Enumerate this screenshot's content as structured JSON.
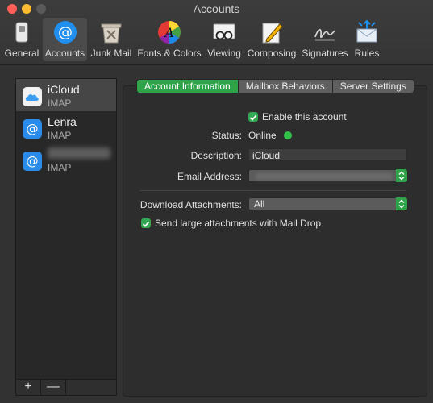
{
  "window": {
    "title": "Accounts"
  },
  "toolbar": {
    "items": [
      {
        "label": "General",
        "icon": "switch-icon"
      },
      {
        "label": "Accounts",
        "icon": "at-sign-icon"
      },
      {
        "label": "Junk Mail",
        "icon": "trash-icon"
      },
      {
        "label": "Fonts & Colors",
        "icon": "color-wheel-icon"
      },
      {
        "label": "Viewing",
        "icon": "glasses-icon"
      },
      {
        "label": "Composing",
        "icon": "pencil-icon"
      },
      {
        "label": "Signatures",
        "icon": "signature-icon"
      },
      {
        "label": "Rules",
        "icon": "envelope-arrows-icon"
      }
    ],
    "active": "Accounts"
  },
  "accounts": [
    {
      "name": "iCloud",
      "type": "IMAP",
      "icon": "cloud-icon",
      "selected": true
    },
    {
      "name": "Lenra",
      "type": "IMAP",
      "icon": "at-sign-icon",
      "selected": false
    },
    {
      "name": "",
      "type": "IMAP",
      "icon": "at-sign-icon",
      "selected": false
    }
  ],
  "list_footer": {
    "add": "+",
    "remove": "—"
  },
  "tabs": [
    "Account Information",
    "Mailbox Behaviors",
    "Server Settings"
  ],
  "active_tab": "Account Information",
  "form": {
    "enable_label": "Enable this account",
    "enable_checked": true,
    "status_label": "Status:",
    "status_value": "Online",
    "description_label": "Description:",
    "description_value": "iCloud",
    "email_label": "Email Address:",
    "download_label": "Download Attachments:",
    "download_value": "All",
    "maildrop_label": "Send large attachments with Mail Drop",
    "maildrop_checked": true
  },
  "colors": {
    "accent_green": "#2fa347",
    "status_online": "#33c04a",
    "window_bg": "#323232"
  }
}
